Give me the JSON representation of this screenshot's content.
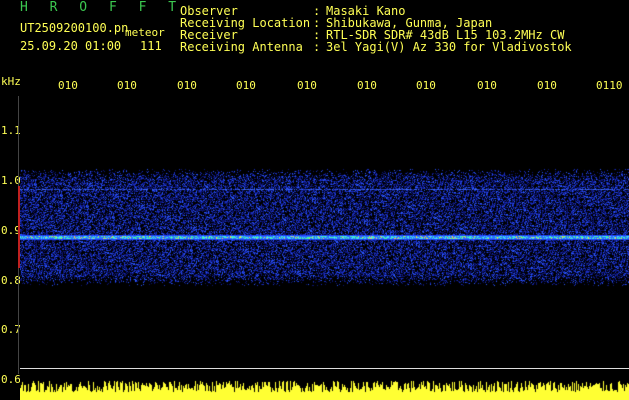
{
  "header": {
    "title": "H R O F F T",
    "filename": "UT2509200100.pn",
    "subtitle": "meteor",
    "datetime": "25.09.20 01:00",
    "count": "111"
  },
  "meta": [
    {
      "label": "Observer",
      "value": "Masaki Kano"
    },
    {
      "label": "Receiving Location",
      "value": "Shibukawa, Gunma, Japan"
    },
    {
      "label": "Receiver",
      "value": "RTL-SDR SDR# 43dB L15 103.2MHz CW"
    },
    {
      "label": "Receiving Antenna",
      "value": "3el Yagi(V) Az 330 for Vladivostok"
    }
  ],
  "meta_separator": ":",
  "y_axis": {
    "unit": "kHz",
    "ticks": [
      "1.1",
      "1.0",
      "0.9",
      "0.8",
      "0.7",
      "0.6"
    ]
  },
  "x_axis": {
    "ticks": [
      "010",
      "010",
      "010",
      "010",
      "010",
      "010",
      "010",
      "010",
      "010",
      "0110"
    ]
  },
  "colors": {
    "text": "#ffff55",
    "title": "#3cc850",
    "background": "#000000",
    "marker": "#c02020"
  }
}
